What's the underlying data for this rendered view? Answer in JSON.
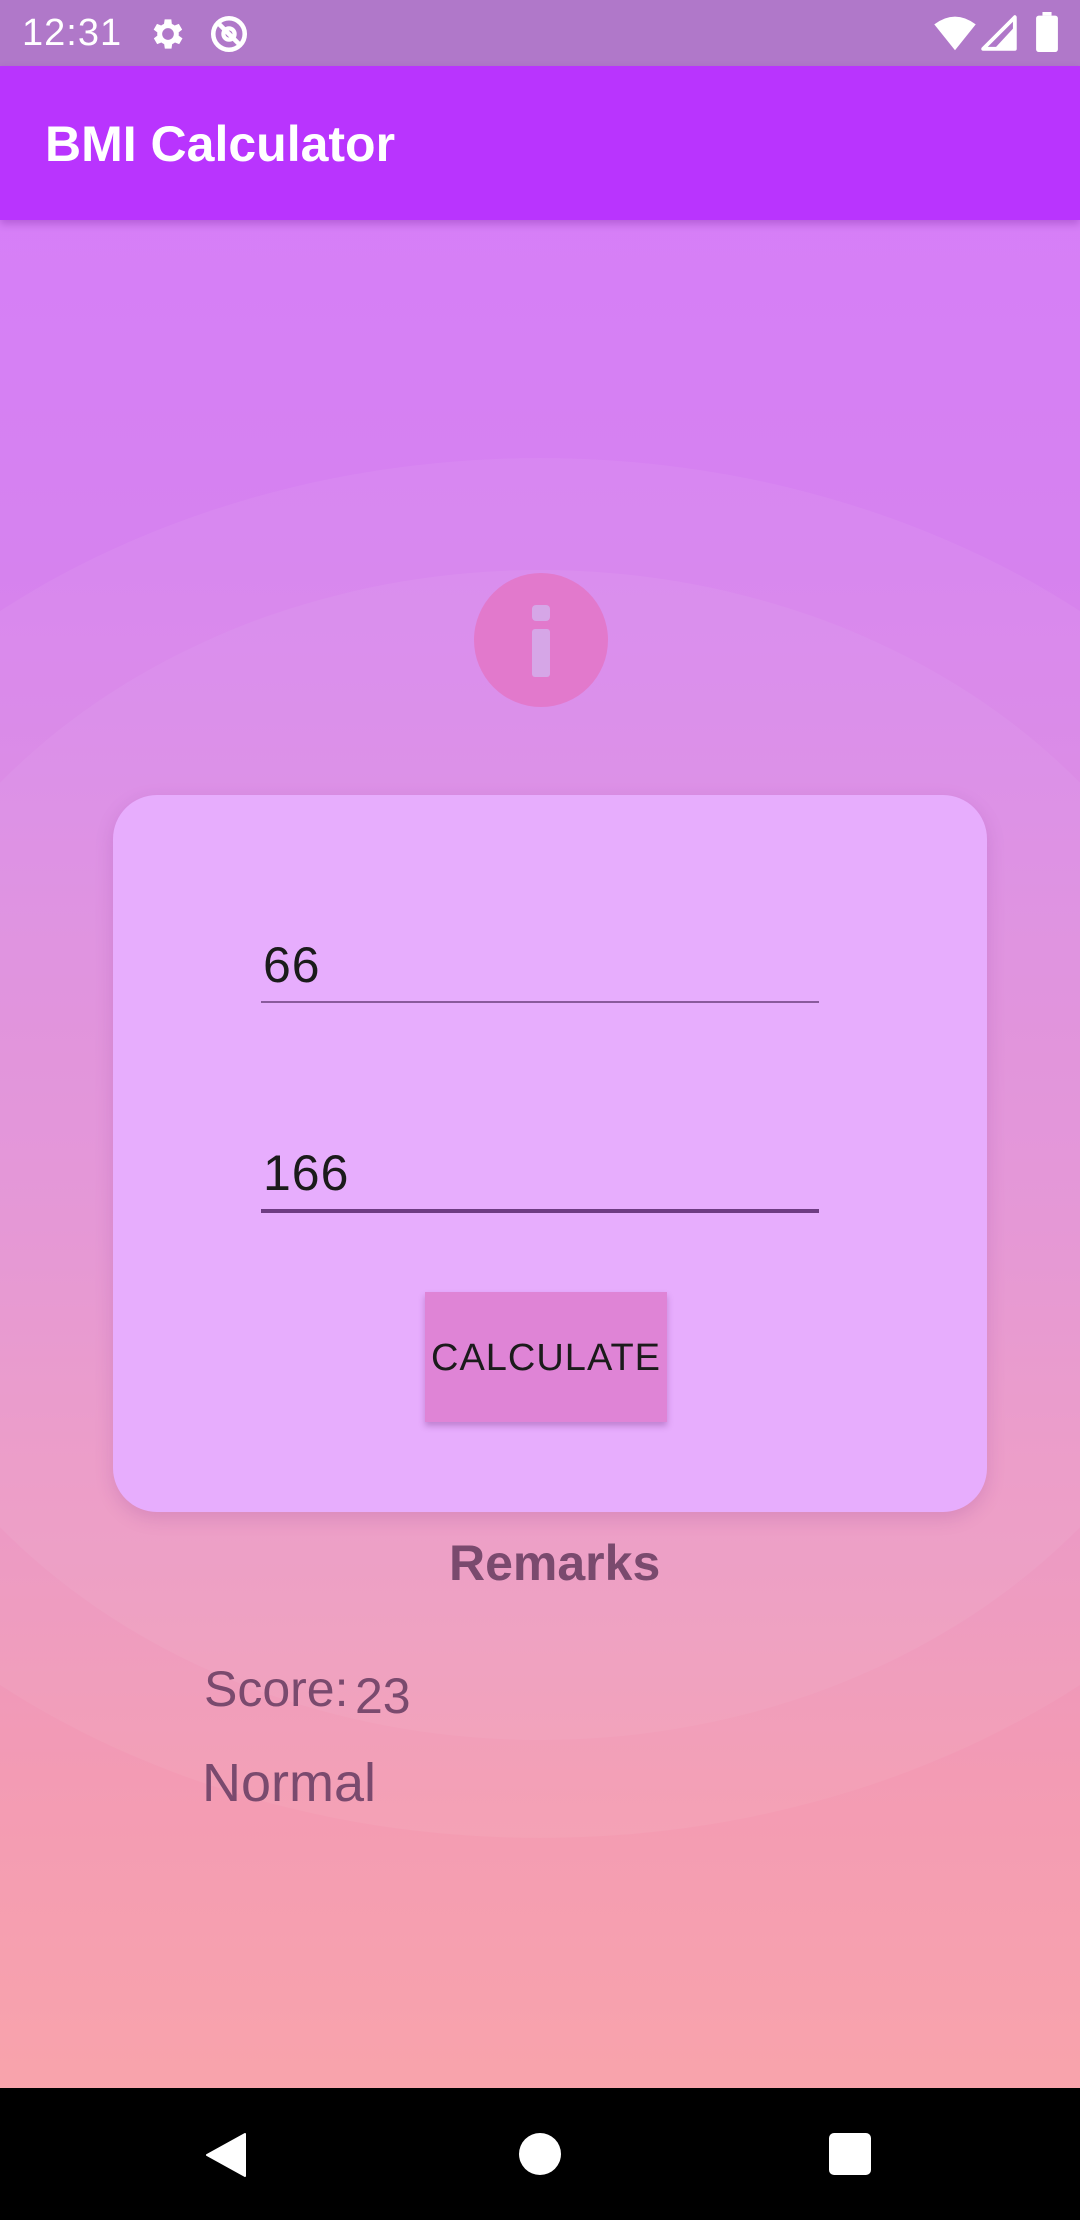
{
  "status_bar": {
    "time": "12:31",
    "icons": [
      "gear-icon",
      "sync-icon",
      "wifi-icon",
      "signal-icon",
      "battery-icon"
    ]
  },
  "app_bar": {
    "title": "BMI Calculator",
    "color": "#b934fe"
  },
  "form": {
    "info_icon": "info-icon",
    "weight_value": "66",
    "height_value": "166",
    "calculate_label": "CALCULATE"
  },
  "results": {
    "remarks_title": "Remarks",
    "score_label": "Score:",
    "score_value": "23",
    "status": "Normal"
  },
  "nav_bar": {
    "icons": [
      "back-icon",
      "home-icon",
      "recents-icon"
    ]
  },
  "colors": {
    "background_top": "#d77cfd",
    "background_bottom": "#fba7a8",
    "card": "#e7adfd",
    "button": "#df84d6",
    "result_text": "#7a4a6e"
  }
}
